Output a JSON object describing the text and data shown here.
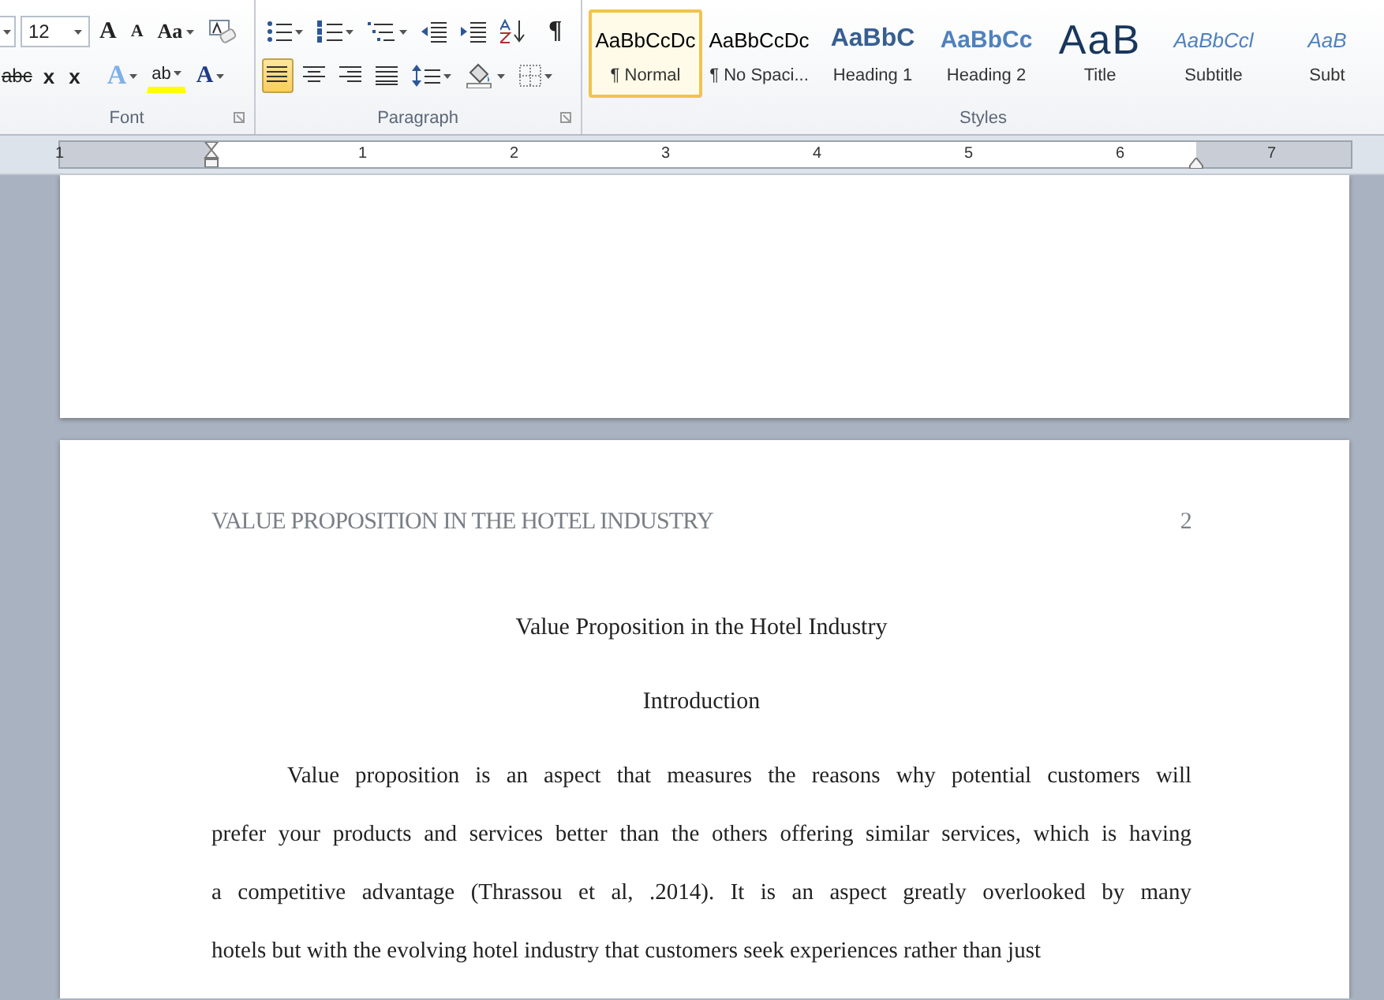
{
  "ribbon": {
    "font": {
      "label": "Font",
      "size": "12",
      "row1": [
        {
          "kind": "grow",
          "text": "A"
        },
        {
          "kind": "shrink",
          "text": "A"
        },
        {
          "kind": "case",
          "text": "Aa"
        },
        {
          "kind": "clear"
        }
      ],
      "row2": [
        {
          "kind": "strike",
          "text": "abc"
        },
        {
          "kind": "sub",
          "text": "x"
        },
        {
          "kind": "sup",
          "text": "x"
        },
        {
          "kind": "effects",
          "text": "A"
        },
        {
          "kind": "highlight",
          "text": "ab"
        },
        {
          "kind": "fontcolor",
          "text": "A"
        }
      ]
    },
    "paragraph": {
      "label": "Paragraph",
      "row1": [
        {
          "kind": "bullets"
        },
        {
          "kind": "numbering"
        },
        {
          "kind": "multilevel"
        },
        {
          "kind": "outdent"
        },
        {
          "kind": "indent"
        },
        {
          "kind": "sort"
        },
        {
          "kind": "pilcrow",
          "text": "¶"
        }
      ],
      "align": [
        {
          "kind": "left",
          "selected": true
        },
        {
          "kind": "center",
          "selected": false
        },
        {
          "kind": "right",
          "selected": false
        },
        {
          "kind": "justify",
          "selected": false
        }
      ],
      "row2": [
        {
          "kind": "spacing"
        },
        {
          "kind": "shading"
        },
        {
          "kind": "borders"
        }
      ]
    },
    "styles": {
      "label": "Styles",
      "items": [
        {
          "kind": "normal",
          "preview": "AaBbCcDc",
          "name": "¶ Normal",
          "selected": true
        },
        {
          "kind": "normal",
          "preview": "AaBbCcDc",
          "name": "¶ No Spaci...",
          "selected": false
        },
        {
          "kind": "heading1",
          "preview": "AaBbC",
          "name": "Heading 1",
          "selected": false
        },
        {
          "kind": "heading2",
          "preview": "AaBbCc",
          "name": "Heading 2",
          "selected": false
        },
        {
          "kind": "title",
          "preview": "AaB",
          "name": "Title",
          "selected": false
        },
        {
          "kind": "subtitle",
          "preview": "AaBbCcl",
          "name": "Subtitle",
          "selected": false
        },
        {
          "kind": "subtle",
          "preview": "AaB",
          "name": "Subt",
          "selected": false
        }
      ]
    }
  },
  "ruler": [
    "1",
    "1",
    "2",
    "3",
    "4",
    "5",
    "6",
    "7"
  ],
  "page": {
    "header": "VALUE PROPOSITION IN THE HOTEL INDUSTRY",
    "page_number": "2",
    "title": "Value Proposition in the Hotel Industry",
    "heading": "Introduction",
    "paragraph": [
      "Value proposition is an aspect that measures the reasons why potential customers will",
      "prefer your products and services better than the others offering similar services, which is having",
      "a competitive advantage (Thrassou et al, .2014). It is an aspect greatly overlooked by many",
      "hotels but with the evolving hotel industry that customers seek experiences rather than just"
    ]
  }
}
